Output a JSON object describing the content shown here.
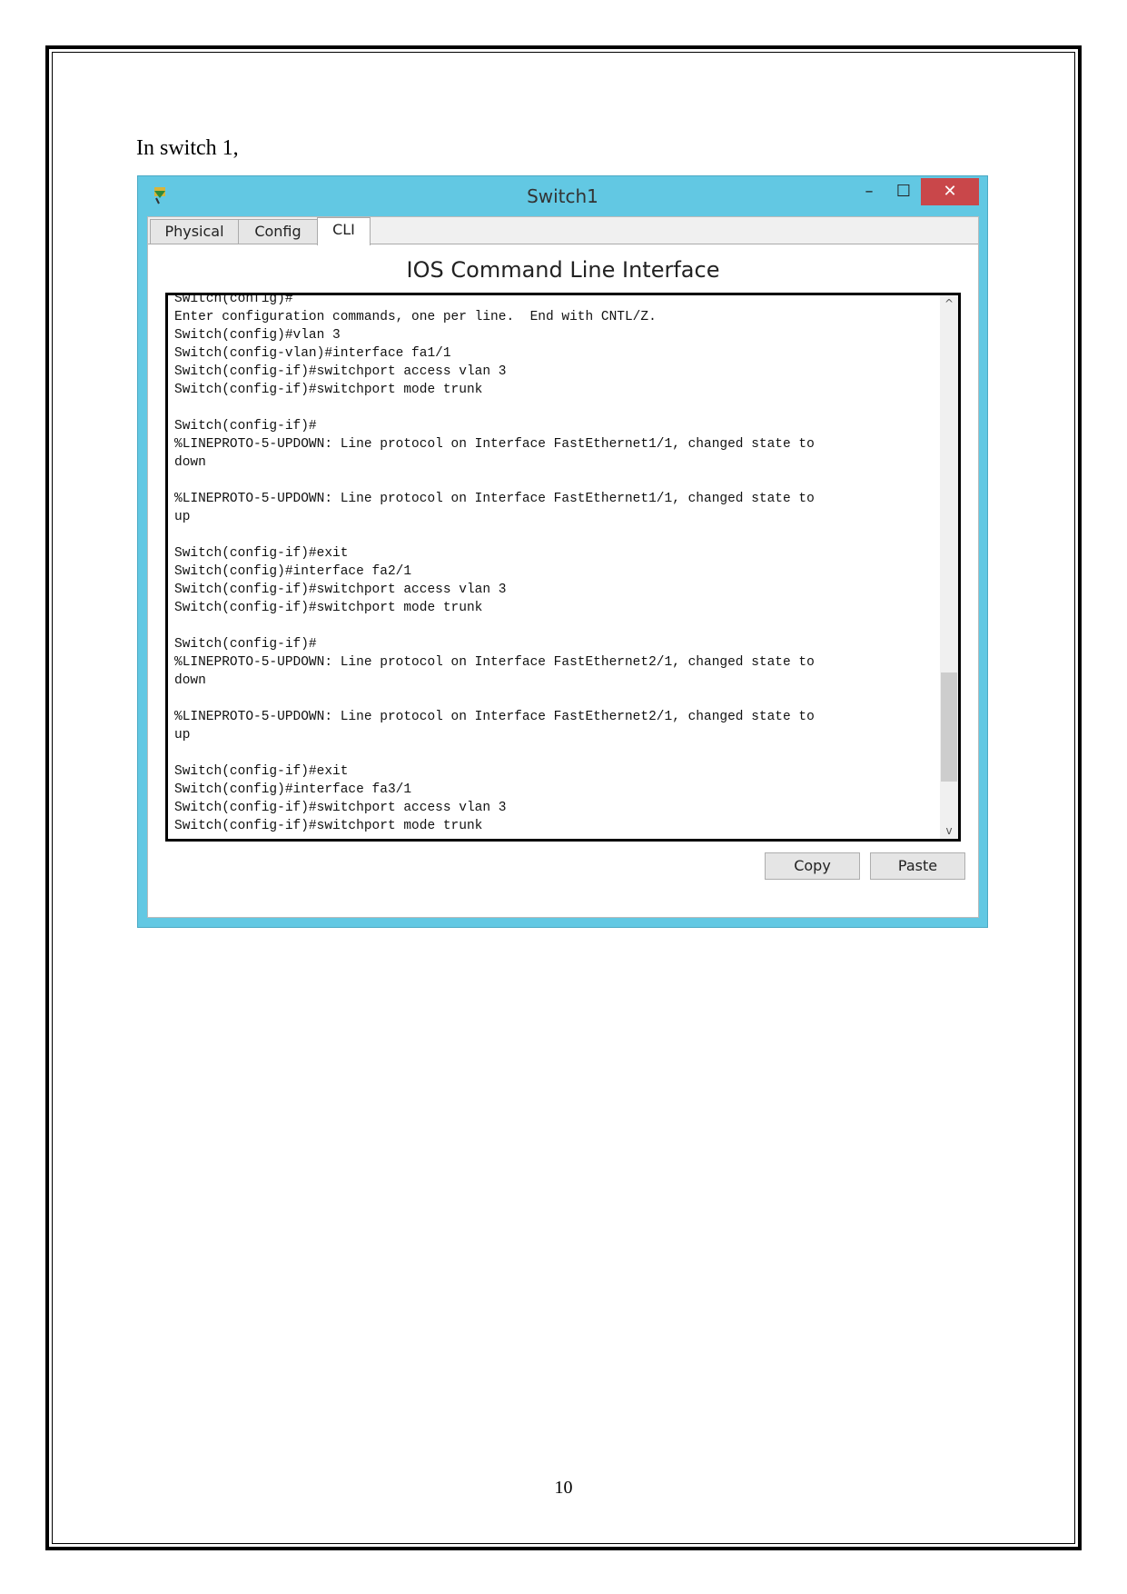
{
  "intro_text": "In switch 1,",
  "page_number": "10",
  "window": {
    "title": "Switch1",
    "minimize": "–",
    "maximize": "☐",
    "close": "✕",
    "tabs": [
      {
        "label": "Physical"
      },
      {
        "label": "Config"
      },
      {
        "label": "CLI"
      }
    ],
    "active_tab": "CLI",
    "heading": "IOS Command Line Interface",
    "terminal_lines": [
      "Switch(config)#",
      "Enter configuration commands, one per line.  End with CNTL/Z.",
      "Switch(config)#vlan 3",
      "Switch(config-vlan)#interface fa1/1",
      "Switch(config-if)#switchport access vlan 3",
      "Switch(config-if)#switchport mode trunk",
      "",
      "Switch(config-if)#",
      "%LINEPROTO-5-UPDOWN: Line protocol on Interface FastEthernet1/1, changed state to",
      "down",
      "",
      "%LINEPROTO-5-UPDOWN: Line protocol on Interface FastEthernet1/1, changed state to",
      "up",
      "",
      "Switch(config-if)#exit",
      "Switch(config)#interface fa2/1",
      "Switch(config-if)#switchport access vlan 3",
      "Switch(config-if)#switchport mode trunk",
      "",
      "Switch(config-if)#",
      "%LINEPROTO-5-UPDOWN: Line protocol on Interface FastEthernet2/1, changed state to",
      "down",
      "",
      "%LINEPROTO-5-UPDOWN: Line protocol on Interface FastEthernet2/1, changed state to",
      "up",
      "",
      "Switch(config-if)#exit",
      "Switch(config)#interface fa3/1",
      "Switch(config-if)#switchport access vlan 3",
      "Switch(config-if)#switchport mode trunk"
    ],
    "copy_label": "Copy",
    "paste_label": "Paste"
  },
  "colors": {
    "titlebar": "#62c8e3",
    "close": "#c9474a"
  }
}
